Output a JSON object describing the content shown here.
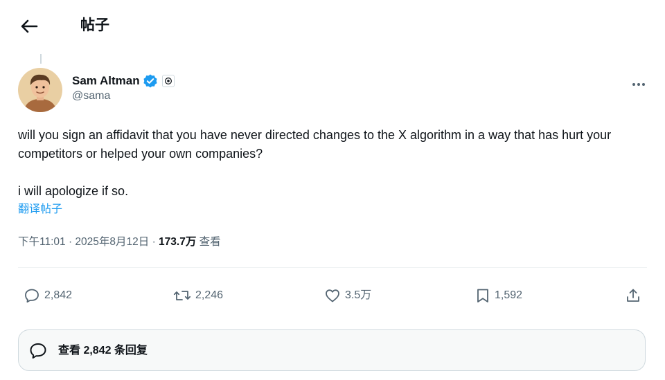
{
  "header": {
    "title": "帖子"
  },
  "author": {
    "display_name": "Sam Altman",
    "handle": "@sama"
  },
  "tweet": {
    "text": "will you sign an affidavit that you have never directed changes to the X algorithm in a way that has hurt your competitors or helped your own companies?\n\ni will apologize if so.",
    "translate_label": "翻译帖子",
    "time": "下午11:01",
    "date": "2025年8月12日",
    "views_count": "173.7万",
    "views_label": "查看"
  },
  "actions": {
    "replies": "2,842",
    "reposts": "2,246",
    "likes": "3.5万",
    "bookmarks": "1,592"
  },
  "reply_bar": {
    "label": "查看 2,842 条回复"
  },
  "colors": {
    "text_primary": "#0f1419",
    "text_secondary": "#536471",
    "accent": "#1d9bf0",
    "verified": "#1d9bf0",
    "border": "#cfd9de"
  }
}
